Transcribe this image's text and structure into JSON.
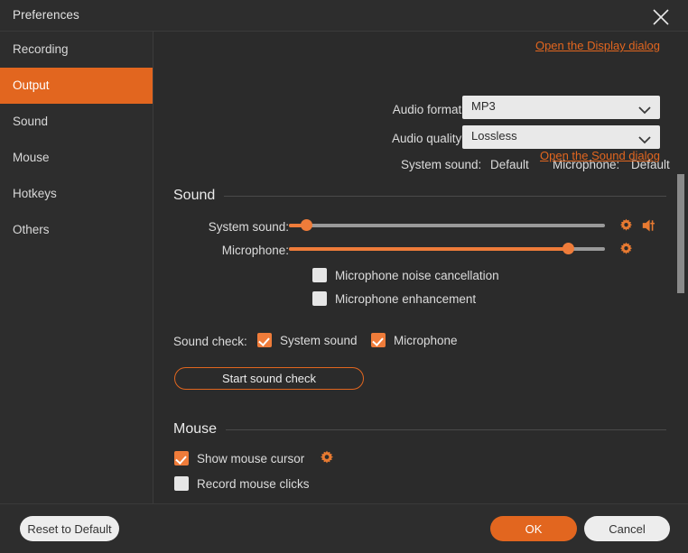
{
  "window": {
    "title": "Preferences",
    "close_icon": "close-icon"
  },
  "accent_color": "#e2661f",
  "sidebar": {
    "items": [
      {
        "label": "Recording",
        "active": false
      },
      {
        "label": "Output",
        "active": true
      },
      {
        "label": "Sound",
        "active": false
      },
      {
        "label": "Mouse",
        "active": false
      },
      {
        "label": "Hotkeys",
        "active": false
      },
      {
        "label": "Others",
        "active": false
      }
    ]
  },
  "output": {
    "display_dialog_link": "Open the Display dialog",
    "audio_format_label": "Audio format:",
    "audio_format_value": "MP3",
    "audio_quality_label": "Audio quality:",
    "audio_quality_value": "Lossless",
    "system_sound_label": "System sound:",
    "system_sound_value": "Default",
    "microphone_label": "Microphone:",
    "microphone_value": "Default",
    "sound_dialog_link": "Open the Sound dialog"
  },
  "sound_section": {
    "title": "Sound",
    "system_sound_label": "System sound:",
    "system_sound_level": 4,
    "system_sound_gear_icon": "gear-icon",
    "system_sound_mute_icon": "speaker-mute-icon",
    "microphone_label": "Microphone:",
    "microphone_level": 90,
    "microphone_gear_icon": "gear-icon",
    "noise_cancellation_label": "Microphone noise cancellation",
    "noise_cancellation_checked": false,
    "enhancement_label": "Microphone enhancement",
    "enhancement_checked": false,
    "sound_check_label": "Sound check:",
    "sound_check_system_label": "System sound",
    "sound_check_system_checked": true,
    "sound_check_mic_label": "Microphone",
    "sound_check_mic_checked": true,
    "start_sound_check_button": "Start sound check"
  },
  "mouse_section": {
    "title": "Mouse",
    "show_cursor_label": "Show mouse cursor",
    "show_cursor_checked": true,
    "show_cursor_gear_icon": "gear-icon",
    "record_clicks_label": "Record mouse clicks",
    "record_clicks_checked": false
  },
  "footer": {
    "reset_label": "Reset to Default",
    "ok_label": "OK",
    "cancel_label": "Cancel"
  }
}
